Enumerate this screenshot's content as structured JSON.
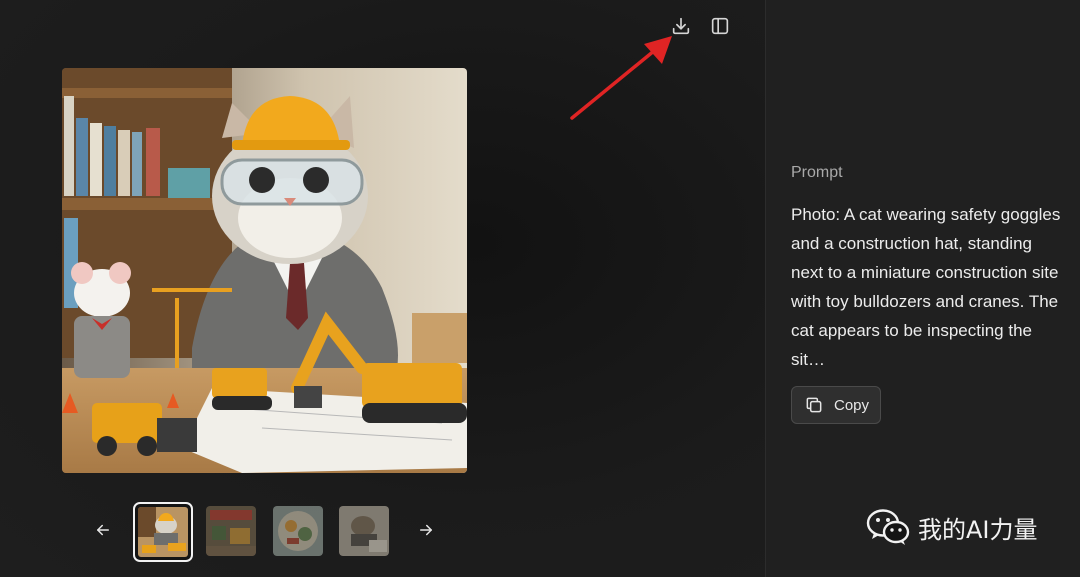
{
  "toolbar": {
    "download_icon": "download-icon",
    "sidebar_icon": "sidebar-toggle-icon"
  },
  "gallery": {
    "thumbnail_count": 4,
    "selected_index": 0,
    "prev_icon": "arrow-left-icon",
    "next_icon": "arrow-right-icon"
  },
  "details": {
    "prompt_label": "Prompt",
    "prompt_text": "Photo: A cat wearing safety goggles and a construction hat, standing next to a miniature construction site with toy bulldozers and cranes. The cat appears to be inspecting the sit…",
    "copy_label": "Copy"
  },
  "watermark": {
    "text": "我的AI力量"
  },
  "colors": {
    "annotation_arrow": "#e02424",
    "panel_bg": "#202020",
    "viewer_bg": "#1b1b1b"
  }
}
